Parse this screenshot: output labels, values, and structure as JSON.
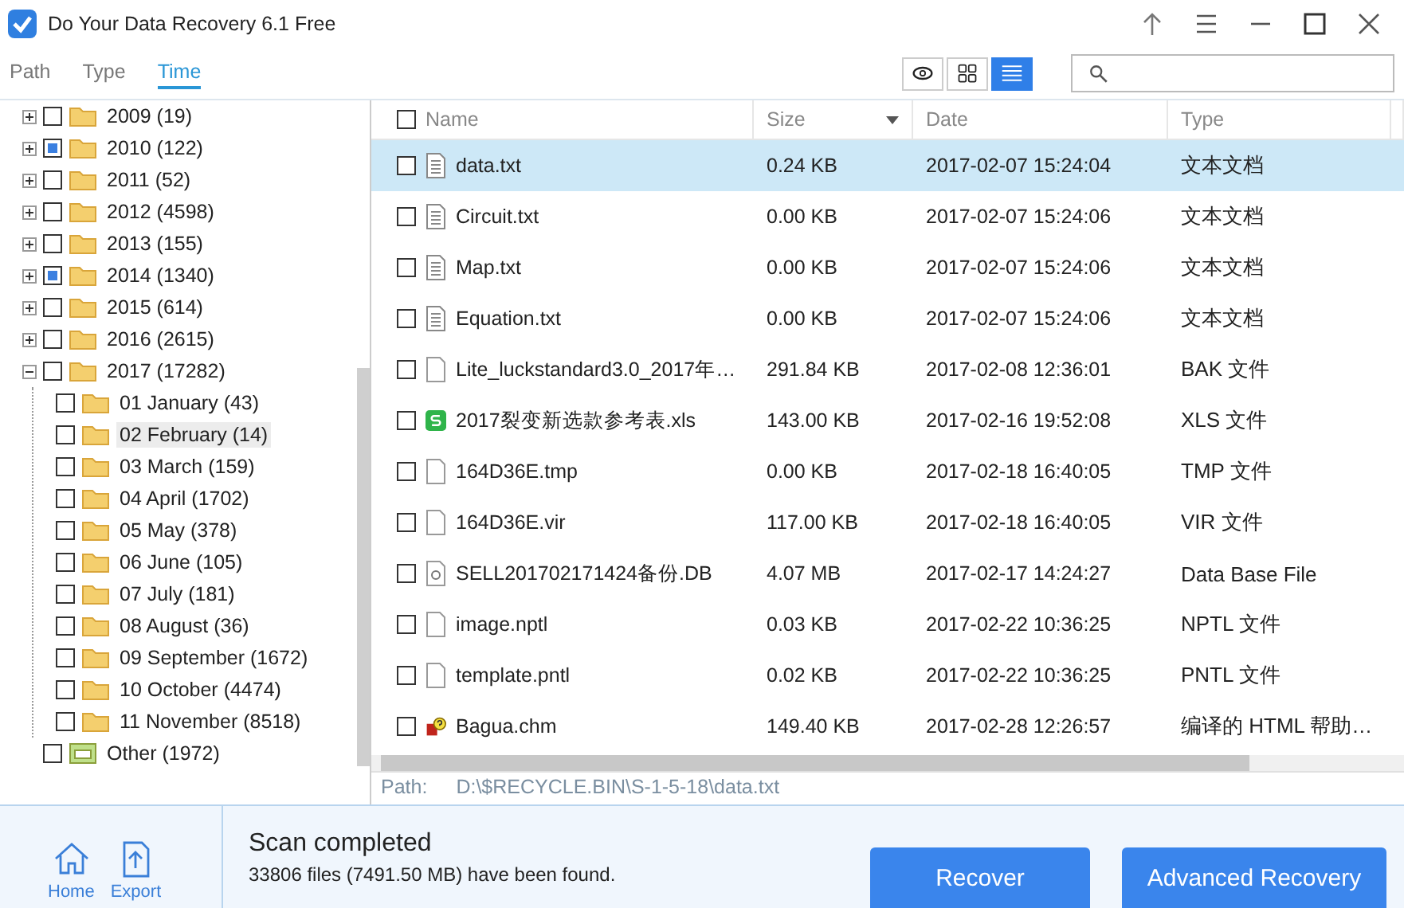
{
  "window": {
    "title": "Do Your Data Recovery 6.1 Free"
  },
  "view_tabs": [
    {
      "label": "Path",
      "selected": false
    },
    {
      "label": "Type",
      "selected": false
    },
    {
      "label": "Time",
      "selected": true
    }
  ],
  "view_modes": [
    {
      "kind": "preview",
      "selected": false
    },
    {
      "kind": "grid",
      "selected": false
    },
    {
      "kind": "list",
      "selected": true
    }
  ],
  "tree": [
    {
      "label": "2009 (19)",
      "kind": "folder",
      "partial": false,
      "expanded": false
    },
    {
      "label": "2010 (122)",
      "kind": "folder",
      "partial": true,
      "expanded": false
    },
    {
      "label": "2011 (52)",
      "kind": "folder",
      "partial": false,
      "expanded": false
    },
    {
      "label": "2012 (4598)",
      "kind": "folder",
      "partial": false,
      "expanded": false
    },
    {
      "label": "2013 (155)",
      "kind": "folder",
      "partial": false,
      "expanded": false
    },
    {
      "label": "2014 (1340)",
      "kind": "folder",
      "partial": true,
      "expanded": false
    },
    {
      "label": "2015 (614)",
      "kind": "folder",
      "partial": false,
      "expanded": false
    },
    {
      "label": "2016 (2615)",
      "kind": "folder",
      "partial": false,
      "expanded": false
    },
    {
      "label": "2017 (17282)",
      "kind": "folder",
      "partial": false,
      "expanded": true,
      "children": [
        {
          "label": "01 January (43)",
          "kind": "folder",
          "partial": false,
          "selected": false
        },
        {
          "label": "02 February (14)",
          "kind": "folder",
          "partial": false,
          "selected": true
        },
        {
          "label": "03 March (159)",
          "kind": "folder",
          "partial": false,
          "selected": false
        },
        {
          "label": "04 April (1702)",
          "kind": "folder",
          "partial": false,
          "selected": false
        },
        {
          "label": "05 May (378)",
          "kind": "folder",
          "partial": false,
          "selected": false
        },
        {
          "label": "06 June (105)",
          "kind": "folder",
          "partial": false,
          "selected": false
        },
        {
          "label": "07 July (181)",
          "kind": "folder",
          "partial": false,
          "selected": false
        },
        {
          "label": "08 August (36)",
          "kind": "folder",
          "partial": false,
          "selected": false
        },
        {
          "label": "09 September (1672)",
          "kind": "folder",
          "partial": false,
          "selected": false
        },
        {
          "label": "10 October (4474)",
          "kind": "folder",
          "partial": false,
          "selected": false
        },
        {
          "label": "11 November (8518)",
          "kind": "folder",
          "partial": false,
          "selected": false
        }
      ]
    },
    {
      "label": "Other (1972)",
      "kind": "other",
      "partial": false
    }
  ],
  "table": {
    "columns": [
      "Name",
      "Size",
      "Date",
      "Type"
    ],
    "all_checked": false,
    "rows": [
      {
        "name": "data.txt",
        "kind": "text",
        "size": "0.24 KB",
        "date": "2017-02-07 15:24:04",
        "type": "文本文档",
        "selected": true
      },
      {
        "name": "Circuit.txt",
        "kind": "text",
        "size": "0.00 KB",
        "date": "2017-02-07 15:24:06",
        "type": "文本文档",
        "selected": false
      },
      {
        "name": "Map.txt",
        "kind": "text",
        "size": "0.00 KB",
        "date": "2017-02-07 15:24:06",
        "type": "文本文档",
        "selected": false
      },
      {
        "name": "Equation.txt",
        "kind": "text",
        "size": "0.00 KB",
        "date": "2017-02-07 15:24:06",
        "type": "文本文档",
        "selected": false
      },
      {
        "name": "Lite_luckstandard3.0_2017年…",
        "kind": "blank",
        "size": "291.84 KB",
        "date": "2017-02-08 12:36:01",
        "type": "BAK 文件",
        "selected": false
      },
      {
        "name": "2017裂变新选款参考表.xls",
        "kind": "sheet",
        "size": "143.00 KB",
        "date": "2017-02-16 19:52:08",
        "type": "XLS 文件",
        "selected": false
      },
      {
        "name": "164D36E.tmp",
        "kind": "blank",
        "size": "0.00 KB",
        "date": "2017-02-18 16:40:05",
        "type": "TMP 文件",
        "selected": false
      },
      {
        "name": "164D36E.vir",
        "kind": "blank",
        "size": "117.00 KB",
        "date": "2017-02-18 16:40:05",
        "type": "VIR 文件",
        "selected": false
      },
      {
        "name": "SELL201702171424备份.DB",
        "kind": "db",
        "size": "4.07 MB",
        "date": "2017-02-17 14:24:27",
        "type": "Data Base File",
        "selected": false
      },
      {
        "name": "image.nptl",
        "kind": "blank",
        "size": "0.03 KB",
        "date": "2017-02-22 10:36:25",
        "type": "NPTL 文件",
        "selected": false
      },
      {
        "name": "template.pntl",
        "kind": "blank",
        "size": "0.02 KB",
        "date": "2017-02-22 10:36:25",
        "type": "PNTL 文件",
        "selected": false
      },
      {
        "name": "Bagua.chm",
        "kind": "help",
        "size": "149.40 KB",
        "date": "2017-02-28 12:26:57",
        "type": "编译的 HTML 帮助…",
        "selected": false
      }
    ]
  },
  "path_bar": {
    "label": "Path:",
    "value": "D:\\$RECYCLE.BIN\\S-1-5-18\\data.txt"
  },
  "bottom": {
    "nav": [
      {
        "label": "Home",
        "kind": "home"
      },
      {
        "label": "Export",
        "kind": "export"
      }
    ],
    "status_title": "Scan completed",
    "status_detail": "33806 files (7491.50 MB) have been found.",
    "buttons": [
      "Recover",
      "Advanced Recovery"
    ]
  }
}
